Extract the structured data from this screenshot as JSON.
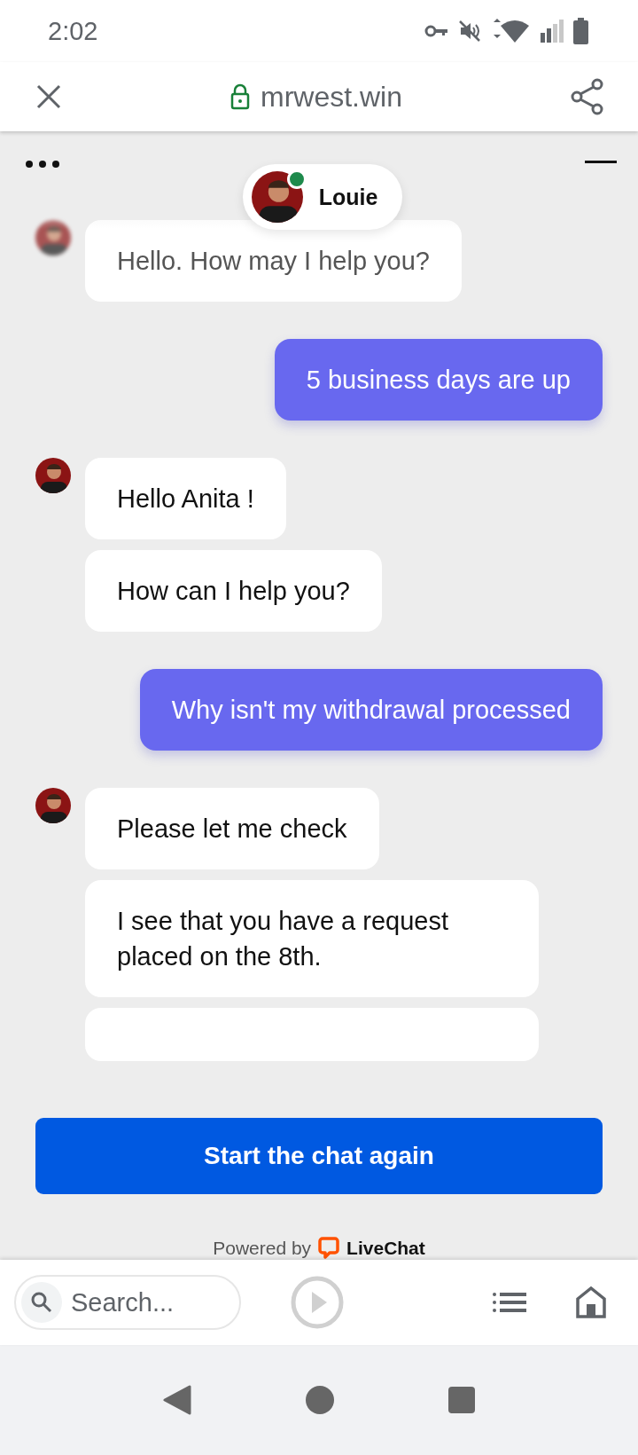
{
  "status_bar": {
    "time": "2:02"
  },
  "browser": {
    "url": "mrwest.win"
  },
  "agent": {
    "name": "Louie",
    "online": true
  },
  "conversation": [
    {
      "kind": "agent",
      "faded": true,
      "bubbles": [
        "Hello. How may I help you?"
      ]
    },
    {
      "kind": "user",
      "faded": false,
      "bubbles": [
        "5 business days are up"
      ]
    },
    {
      "kind": "agent",
      "faded": false,
      "bubbles": [
        "Hello Anita !",
        "How can I help you?"
      ]
    },
    {
      "kind": "user",
      "faded": false,
      "bubbles": [
        "Why isn't my withdrawal processed"
      ]
    },
    {
      "kind": "agent",
      "faded": false,
      "bubbles": [
        "Please let me check",
        "I see that you have a request placed on the 8th."
      ],
      "cut_bubble": true
    }
  ],
  "restart_button": "Start the chat again",
  "powered_by": {
    "label": "Powered by",
    "brand": "LiveChat"
  },
  "toolbar": {
    "search": {
      "placeholder": "Search..."
    }
  }
}
